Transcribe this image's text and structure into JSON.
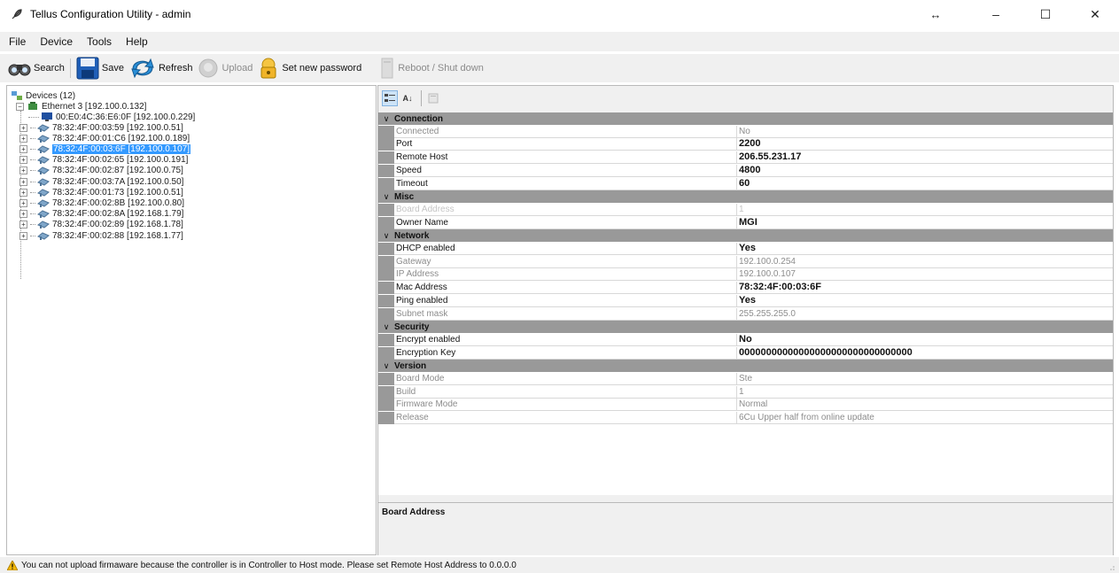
{
  "window": {
    "title": "Tellus Configuration Utility - admin",
    "controls": {
      "resize": "↔",
      "minimize": "–",
      "maximize": "☐",
      "close": "✕"
    }
  },
  "menu": [
    "File",
    "Device",
    "Tools",
    "Help"
  ],
  "toolbar": {
    "search": "Search",
    "save": "Save",
    "refresh": "Refresh",
    "upload": "Upload",
    "set_password": "Set new password",
    "reboot": "Reboot / Shut down"
  },
  "tree": {
    "root": "Devices (12)",
    "adapter": "Ethernet 3 [192.100.0.132]",
    "host": "00:E0:4C:36:E6:0F [192.100.0.229]",
    "devices": [
      "78:32:4F:00:03:59 [192.100.0.51]",
      "78:32:4F:00:01:C6 [192.100.0.189]",
      "78:32:4F:00:03:6F [192.100.0.107]",
      "78:32:4F:00:02:65 [192.100.0.191]",
      "78:32:4F:00:02:87 [192.100.0.75]",
      "78:32:4F:00:03:7A [192.100.0.50]",
      "78:32:4F:00:01:73 [192.100.0.51]",
      "78:32:4F:00:02:8B [192.100.0.80]",
      "78:32:4F:00:02:8A [192.168.1.79]",
      "78:32:4F:00:02:89 [192.168.1.78]",
      "78:32:4F:00:02:88 [192.168.1.77]"
    ],
    "selected_index": 2
  },
  "grid": {
    "categories": [
      {
        "name": "Connection",
        "rows": [
          {
            "name": "Connected",
            "value": "No",
            "state": "ro"
          },
          {
            "name": "Port",
            "value": "2200",
            "state": "bold"
          },
          {
            "name": "Remote Host",
            "value": "206.55.231.17",
            "state": "bold"
          },
          {
            "name": "Speed",
            "value": "4800",
            "state": "bold"
          },
          {
            "name": "Timeout",
            "value": "60",
            "state": "bold"
          }
        ]
      },
      {
        "name": "Misc",
        "rows": [
          {
            "name": "Board Address",
            "value": "1",
            "state": "disabled"
          },
          {
            "name": "Owner Name",
            "value": "MGI",
            "state": "bold"
          }
        ]
      },
      {
        "name": "Network",
        "rows": [
          {
            "name": "DHCP enabled",
            "value": "Yes",
            "state": "bold"
          },
          {
            "name": "Gateway",
            "value": "192.100.0.254",
            "state": "ro"
          },
          {
            "name": "IP Address",
            "value": "192.100.0.107",
            "state": "ro"
          },
          {
            "name": "Mac Address",
            "value": "78:32:4F:00:03:6F",
            "state": "bold"
          },
          {
            "name": "Ping enabled",
            "value": "Yes",
            "state": "bold"
          },
          {
            "name": "Subnet mask",
            "value": "255.255.255.0",
            "state": "ro"
          }
        ]
      },
      {
        "name": "Security",
        "rows": [
          {
            "name": "Encrypt enabled",
            "value": "No",
            "state": "bold"
          },
          {
            "name": "Encryption Key",
            "value": "00000000000000000000000000000000",
            "state": "bold"
          }
        ]
      },
      {
        "name": "Version",
        "rows": [
          {
            "name": "Board Mode",
            "value": "Ste",
            "state": "ro"
          },
          {
            "name": "Build",
            "value": "1",
            "state": "ro"
          },
          {
            "name": "Firmware Mode",
            "value": "Normal",
            "state": "ro"
          },
          {
            "name": "Release",
            "value": "6Cu Upper half from online update",
            "state": "ro"
          }
        ]
      }
    ],
    "description_title": "Board Address"
  },
  "status": {
    "message": "You can not upload firmaware because the controller is in Controller to Host mode. Please set Remote Host Address to 0.0.0.0"
  },
  "colors": {
    "selection": "#3399ff",
    "category_bar": "#999999",
    "warning": "#f2b705"
  }
}
